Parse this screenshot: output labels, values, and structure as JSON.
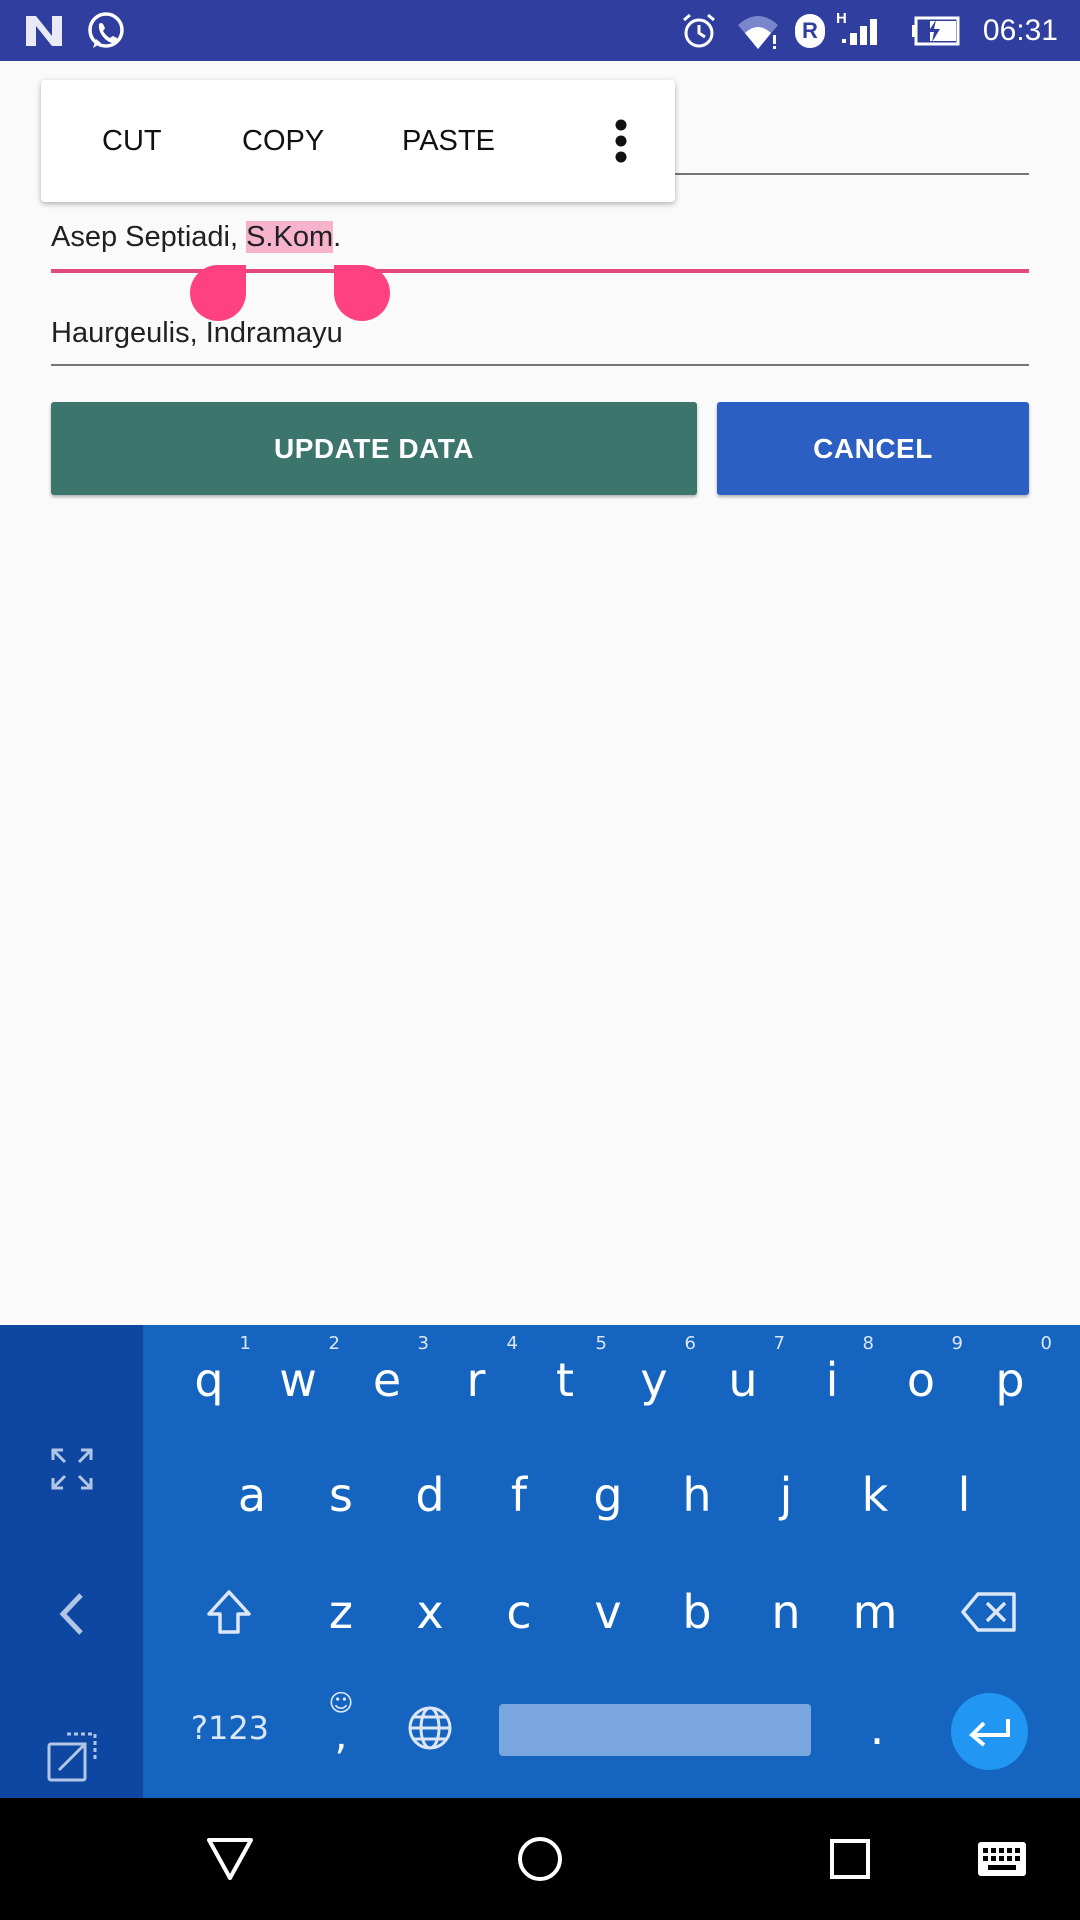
{
  "status_bar": {
    "time": "06:31",
    "left_icons": [
      "n-logo-icon",
      "whatsapp-icon"
    ],
    "right_icons": [
      "alarm-icon",
      "wifi-icon",
      "roaming-icon",
      "signal-icon",
      "battery-charging-icon"
    ],
    "network_label": "H",
    "roaming_label": "R",
    "background": "#303f9f"
  },
  "context_menu": {
    "cut": "CUT",
    "copy": "COPY",
    "paste": "PASTE"
  },
  "form": {
    "name_before": "Asep Septiadi, ",
    "name_selected": "S.Kom",
    "name_after": ".",
    "address": "Haurgeulis, Indramayu"
  },
  "buttons": {
    "update": "UPDATE DATA",
    "cancel": "CANCEL",
    "update_color": "#3b756c",
    "cancel_color": "#2b5fc4"
  },
  "keyboard": {
    "row1": [
      {
        "k": "q",
        "h": "1"
      },
      {
        "k": "w",
        "h": "2"
      },
      {
        "k": "e",
        "h": "3"
      },
      {
        "k": "r",
        "h": "4"
      },
      {
        "k": "t",
        "h": "5"
      },
      {
        "k": "y",
        "h": "6"
      },
      {
        "k": "u",
        "h": "7"
      },
      {
        "k": "i",
        "h": "8"
      },
      {
        "k": "o",
        "h": "9"
      },
      {
        "k": "p",
        "h": "0"
      }
    ],
    "row2": [
      "a",
      "s",
      "d",
      "f",
      "g",
      "h",
      "j",
      "k",
      "l"
    ],
    "row3": [
      "z",
      "x",
      "c",
      "v",
      "b",
      "n",
      "m"
    ],
    "symbols_label": "?123",
    "comma_label": ",",
    "period_label": ".",
    "background": "#1565c0"
  },
  "nav_bar": {
    "icons": [
      "back-icon",
      "home-icon",
      "recents-icon",
      "keyboard-icon"
    ]
  }
}
